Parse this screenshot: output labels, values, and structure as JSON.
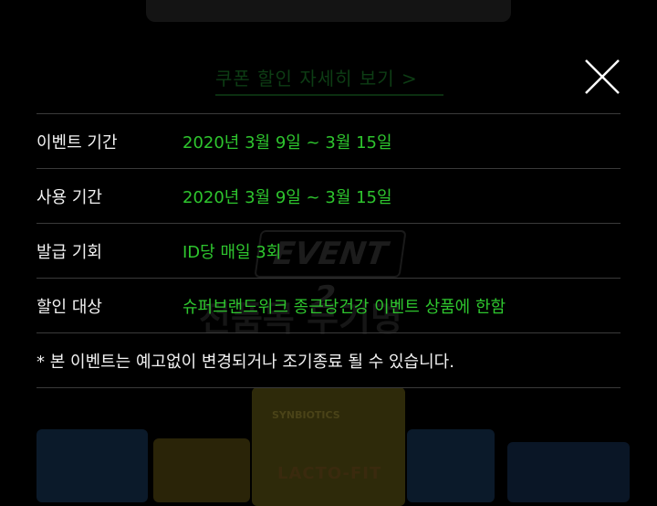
{
  "background": {
    "coupon_link": "쿠폰 할인 자세히 보기 >",
    "event_badge": "EVENT 2",
    "headline": "전품목 무기명",
    "product_brand_small": "SYNBIOTICS",
    "product_name": "LACTO-FIT"
  },
  "modal": {
    "close_icon": "close-icon",
    "rows": [
      {
        "label": "이벤트 기간",
        "value": "2020년 3월 9일 ~ 3월 15일"
      },
      {
        "label": "사용 기간",
        "value": "2020년 3월 9일 ~ 3월 15일"
      },
      {
        "label": "발급 기회",
        "value": "ID당 매일 3회"
      },
      {
        "label": "할인 대상",
        "value": "슈퍼브랜드위크 종근당건강 이벤트 상품에 한함"
      }
    ],
    "notice": "* 본 이벤트는 예고없이 변경되거나 조기종료 될 수 있습니다."
  },
  "colors": {
    "overlay": "#000000",
    "accent_green": "#2ec52e",
    "text": "#f2f2f2",
    "divider": "#3a3a3a"
  }
}
